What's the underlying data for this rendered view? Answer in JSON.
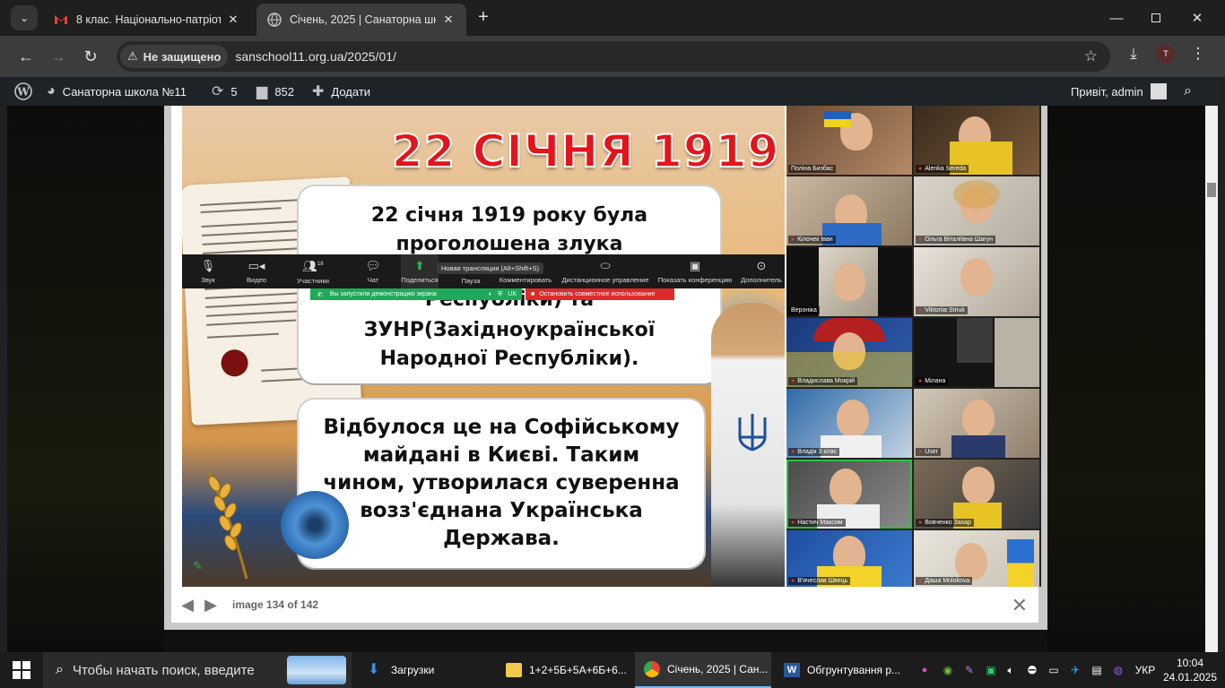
{
  "browser": {
    "tab_search_icon": "chevron-down-icon",
    "tabs": [
      {
        "title": "8 клас. Національно-патріотич",
        "favicon": "gmail-icon",
        "active": false
      },
      {
        "title": "Січень, 2025 | Санаторна школ",
        "favicon": "globe-icon",
        "active": true
      }
    ],
    "close_glyph": "✕",
    "new_tab_glyph": "+",
    "address": {
      "security_label": "Не защищено",
      "url": "sanschool11.org.ua/2025/01/"
    },
    "profile_initial": "T"
  },
  "wp_admin_bar": {
    "site_name": "Санаторна школа №11",
    "updates_count": "5",
    "comments_count": "852",
    "add_label": "Додати",
    "greeting": "Привіт, admin"
  },
  "lightbox": {
    "caption": "image 134 of 142",
    "prev_glyph": "◀",
    "next_glyph": "▶",
    "close_glyph": "✕"
  },
  "slide": {
    "title": "22 СІЧНЯ 1919",
    "bubble1": {
      "line1": "22 січня 1919 року була",
      "line2": "проголошена злука",
      "line3": "Республіки) та",
      "line4": "ЗУНР(Західноукраїнської",
      "line5": "Народної Республіки)."
    },
    "bubble2": {
      "line1": "Відбулося це на Софійському",
      "line2": "майдані в Києві. Таким",
      "line3": "чином, утворилася суверенна",
      "line4": "возз'єднана Українська",
      "line5": "Держава."
    }
  },
  "zoom": {
    "buttons": [
      {
        "label": "Звук",
        "icon": "microphone-icon"
      },
      {
        "label": "Видео",
        "icon": "video-camera-icon"
      },
      {
        "label": "Участники",
        "icon": "participants-icon",
        "count": "18"
      },
      {
        "label": "Чат",
        "icon": "chat-icon"
      },
      {
        "label": "Поделиться",
        "icon": "share-screen-icon"
      },
      {
        "label": "Пауза",
        "icon": "pause-icon"
      },
      {
        "label": "Комментировать",
        "icon": "annotate-icon"
      },
      {
        "label": "Дистанционное управление",
        "icon": "remote-control-icon"
      },
      {
        "label": "Показать конференцию",
        "icon": "show-meeting-icon"
      },
      {
        "label": "Дополнитель",
        "icon": "more-icon"
      }
    ],
    "tooltip": "Новая трансляция (Alt+Shift+S)",
    "status_text": "Вы запустили демонстрацию экрана",
    "status_lang": "UK",
    "stop_text": "Остановить совместное использование"
  },
  "gallery": {
    "participants": [
      {
        "name": "Поліна Бизбас",
        "muted": false
      },
      {
        "name": "Alenka Sereda",
        "muted": true
      },
      {
        "name": "Кілочек Іван",
        "muted": true
      },
      {
        "name": "Ольга Віталіївна Шагун",
        "muted": true
      },
      {
        "name": "Вероніка",
        "muted": false
      },
      {
        "name": "Viktoriia Striuk",
        "muted": true
      },
      {
        "name": "Владислава Мокрій",
        "muted": true
      },
      {
        "name": "Мілана",
        "muted": true
      },
      {
        "name": "Владік 3 клас",
        "muted": true
      },
      {
        "name": "User",
        "muted": true
      },
      {
        "name": "Настич Максим",
        "muted": true,
        "speaking": true
      },
      {
        "name": "Вовченко Захар",
        "muted": true
      },
      {
        "name": "В'ячеслав Швець",
        "muted": true
      },
      {
        "name": "Даша Molokova",
        "muted": true
      }
    ]
  },
  "taskbar": {
    "search_placeholder": "Чтобы начать поиск, введите",
    "items": [
      {
        "title": "Загрузки",
        "icon": "download-folder-icon"
      },
      {
        "title": "1+2+5Б+5А+6Б+6...",
        "icon": "folder-icon"
      },
      {
        "title": "Січень, 2025 | Сан...",
        "icon": "chrome-icon"
      },
      {
        "title": "Обгрунтування р...",
        "icon": "word-icon"
      }
    ],
    "language": "УКР",
    "time": "10:04",
    "date": "24.01.2025"
  },
  "colors": {
    "chrome_tabstrip": "#1f1f1f",
    "chrome_toolbar": "#3c3c3c",
    "wp_bar": "#1d2327",
    "slide_title_red": "#e3141b",
    "zoom_share_green": "#25c245",
    "zoom_stop_red": "#e02a2a"
  }
}
